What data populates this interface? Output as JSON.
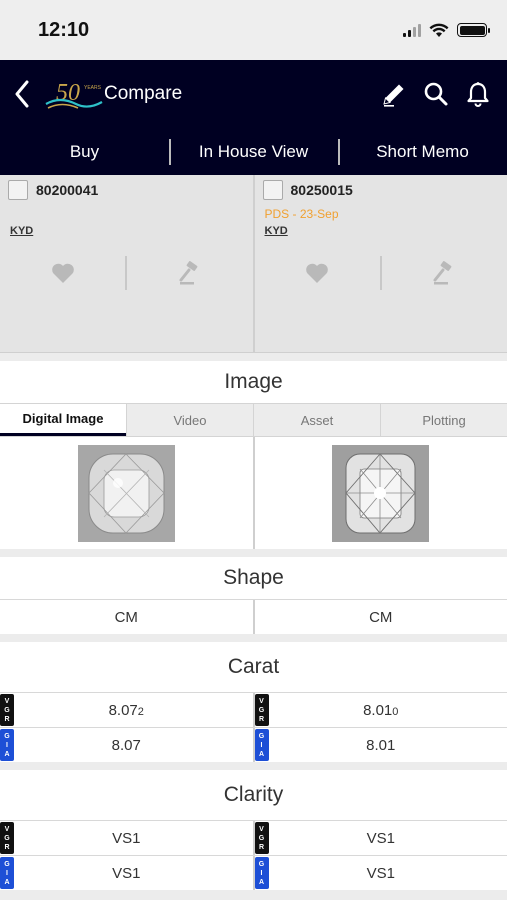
{
  "status": {
    "time": "12:10"
  },
  "nav": {
    "title": "Compare"
  },
  "segments": [
    "Buy",
    "In House View",
    "Short Memo"
  ],
  "stones": [
    {
      "id": "80200041",
      "pds": "",
      "kyd": "KYD"
    },
    {
      "id": "80250015",
      "pds": "PDS - 23-Sep",
      "kyd": "KYD"
    }
  ],
  "image_section": {
    "title": "Image",
    "tabs": [
      "Digital Image",
      "Video",
      "Asset",
      "Plotting"
    ],
    "active_tab": "Digital Image"
  },
  "shape": {
    "title": "Shape",
    "values": [
      "CM",
      "CM"
    ]
  },
  "carat": {
    "title": "Carat",
    "vgr_label": "VGR",
    "gia_label": "GIA",
    "vgr": [
      {
        "main": "8.07",
        "sub": "2"
      },
      {
        "main": "8.01",
        "sub": "0"
      }
    ],
    "gia": [
      "8.07",
      "8.01"
    ]
  },
  "clarity": {
    "title": "Clarity",
    "vgr": [
      "VS1",
      "VS1"
    ],
    "gia": [
      "VS1",
      "VS1"
    ]
  },
  "colors": {
    "nav_bg": "#000022",
    "pds": "#f0a030",
    "gia_badge": "#1d4fd6",
    "vgr_badge": "#111111"
  }
}
